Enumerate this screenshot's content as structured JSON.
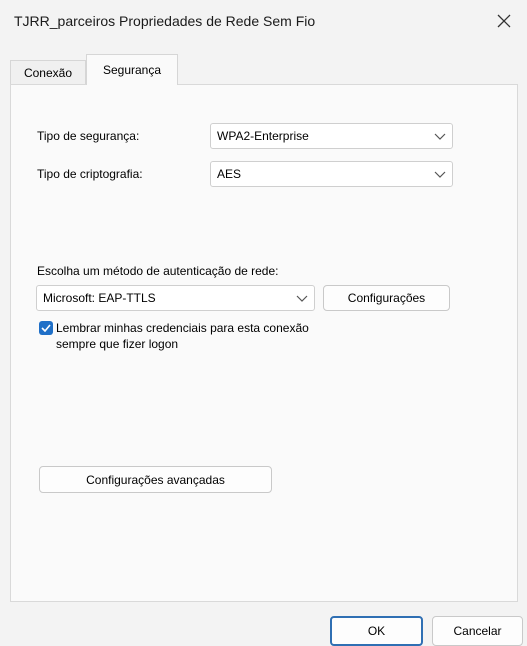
{
  "window": {
    "title": "TJRR_parceiros Propriedades de Rede Sem Fio",
    "close_icon": "close-icon"
  },
  "tabs": [
    {
      "label": "Conexão",
      "active": false
    },
    {
      "label": "Segurança",
      "active": true
    }
  ],
  "security": {
    "type_label": "Tipo de segurança:",
    "type_value": "WPA2-Enterprise",
    "encryption_label": "Tipo de criptografia:",
    "encryption_value": "AES"
  },
  "auth": {
    "method_label": "Escolha um método de autenticação de rede:",
    "method_value": "Microsoft: EAP-TTLS",
    "settings_button": "Configurações",
    "remember_line1": "Lembrar minhas credenciais para esta conexão",
    "remember_line2": "sempre que fizer logon",
    "remember_checked": true
  },
  "advanced": {
    "button": "Configurações avançadas"
  },
  "footer": {
    "ok": "OK",
    "cancel": "Cancelar"
  },
  "colors": {
    "accent": "#1f6fc7",
    "background": "#f3f3f3",
    "panel": "#fafafa"
  }
}
